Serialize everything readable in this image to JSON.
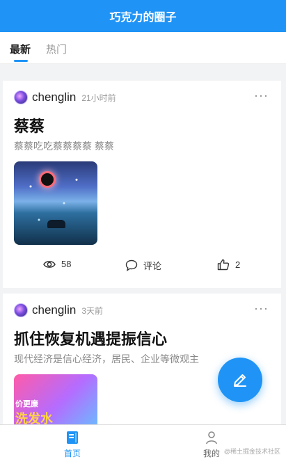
{
  "header": {
    "title": "巧克力的圈子"
  },
  "tabs": [
    {
      "label": "最新",
      "active": true
    },
    {
      "label": "热门",
      "active": false
    }
  ],
  "posts": [
    {
      "author": "chenglin",
      "time": "21小时前",
      "more": "···",
      "title": "蔡蔡",
      "summary": "蔡蔡吃吃蔡蔡蔡蔡 蔡蔡",
      "image_icon": "night-sky-image",
      "views": "58",
      "comment_label": "评论",
      "likes": "2"
    },
    {
      "author": "chenglin",
      "time": "3天前",
      "more": "···",
      "title": "抓住恢复机遇提振信心",
      "summary": "现代经济是信心经济，居民、企业等微观主",
      "image_text_1": "价更廉",
      "image_text_2": "洗发水"
    }
  ],
  "fab": {
    "icon": "pencil-icon"
  },
  "tabbar": {
    "items": [
      {
        "label": "首页",
        "icon": "home-book-icon",
        "active": true
      },
      {
        "label": "我的",
        "icon": "user-icon",
        "active": false
      }
    ],
    "watermark": "@稀土掘金技术社区"
  },
  "colors": {
    "accent": "#1f94f6",
    "text": "#222222",
    "muted": "#999999"
  }
}
